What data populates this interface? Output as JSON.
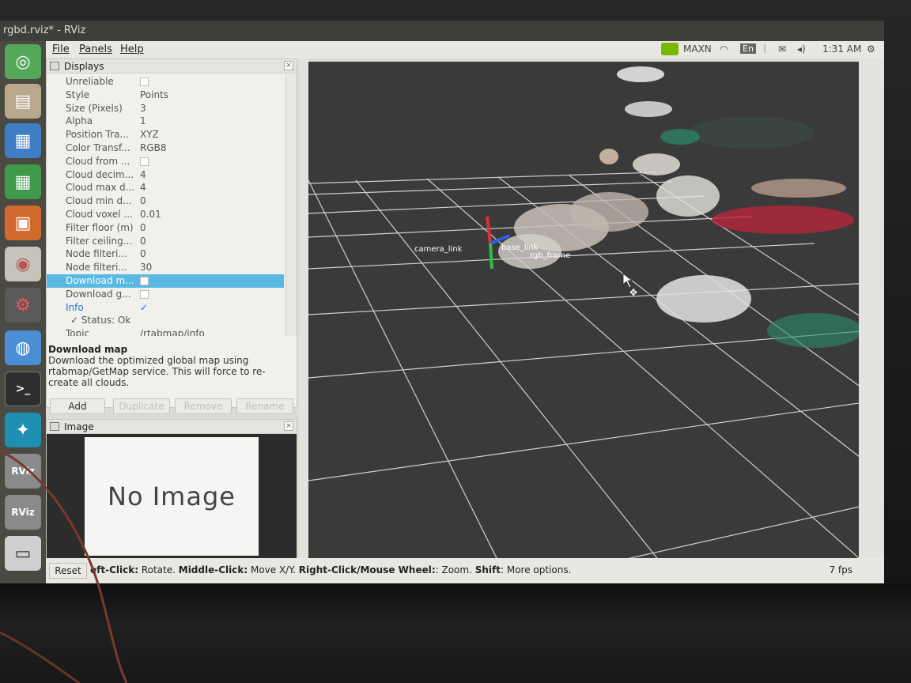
{
  "window": {
    "title": "rgbd.rviz* - RViz"
  },
  "menubar": {
    "file": "File",
    "panels": "Panels",
    "help": "Help"
  },
  "tray": {
    "gpu_mode": "MAXN",
    "keyboard": "En",
    "time": "1:31 AM"
  },
  "launcher": {
    "items": [
      "ubuntu-icon",
      "files-icon",
      "writer-icon",
      "calc-icon",
      "impress-icon",
      "software-icon",
      "settings-icon",
      "chromium-icon",
      "terminal-icon",
      "display-icon",
      "rviz-icon",
      "rviz-icon",
      "drive-icon"
    ],
    "rviz_label": "RViz"
  },
  "displays": {
    "title": "Displays",
    "rows": [
      {
        "name": "Unreliable",
        "value": "",
        "type": "checkbox"
      },
      {
        "name": "Style",
        "value": "Points"
      },
      {
        "name": "Size (Pixels)",
        "value": "3"
      },
      {
        "name": "Alpha",
        "value": "1"
      },
      {
        "name": "Position Tra...",
        "value": "XYZ"
      },
      {
        "name": "Color Transf...",
        "value": "RGB8"
      },
      {
        "name": "Cloud from ...",
        "value": "",
        "type": "checkbox"
      },
      {
        "name": "Cloud decim...",
        "value": "4"
      },
      {
        "name": "Cloud max d...",
        "value": "4"
      },
      {
        "name": "Cloud min d...",
        "value": "0"
      },
      {
        "name": "Cloud voxel ...",
        "value": "0.01"
      },
      {
        "name": "Filter floor (m)",
        "value": "0"
      },
      {
        "name": "Filter ceiling...",
        "value": "0"
      },
      {
        "name": "Node filteri...",
        "value": "0"
      },
      {
        "name": "Node filteri...",
        "value": "30"
      },
      {
        "name": "Download m...",
        "value": "",
        "type": "checkbox",
        "selected": true
      },
      {
        "name": "Download g...",
        "value": "",
        "type": "checkbox"
      },
      {
        "name": "Info",
        "value": "✓",
        "type": "info"
      },
      {
        "name": "✓ Status: Ok",
        "value": "",
        "type": "status"
      },
      {
        "name": "Topic",
        "value": "/rtabmap/info"
      }
    ],
    "desc_title": "Download map",
    "desc_text": "Download the optimized global map using rtabmap/GetMap service. This will force to re-create all clouds.",
    "buttons": {
      "add": "Add",
      "duplicate": "Duplicate",
      "remove": "Remove",
      "rename": "Rename"
    }
  },
  "image_panel": {
    "title": "Image",
    "placeholder": "No Image"
  },
  "viewport": {
    "frame_label_1": "camera_link",
    "frame_label_2": "base_link",
    "frame_label_3": "rgb_frame"
  },
  "statusbar": {
    "reset": "Reset",
    "k1": "eft-Click:",
    "v1": " Rotate. ",
    "k2": "Middle-Click:",
    "v2": " Move X/Y. ",
    "k3": "Right-Click/Mouse Wheel:",
    "v3": ": Zoom. ",
    "k4": "Shift",
    "v4": ": More options.",
    "fps": "7 fps"
  }
}
